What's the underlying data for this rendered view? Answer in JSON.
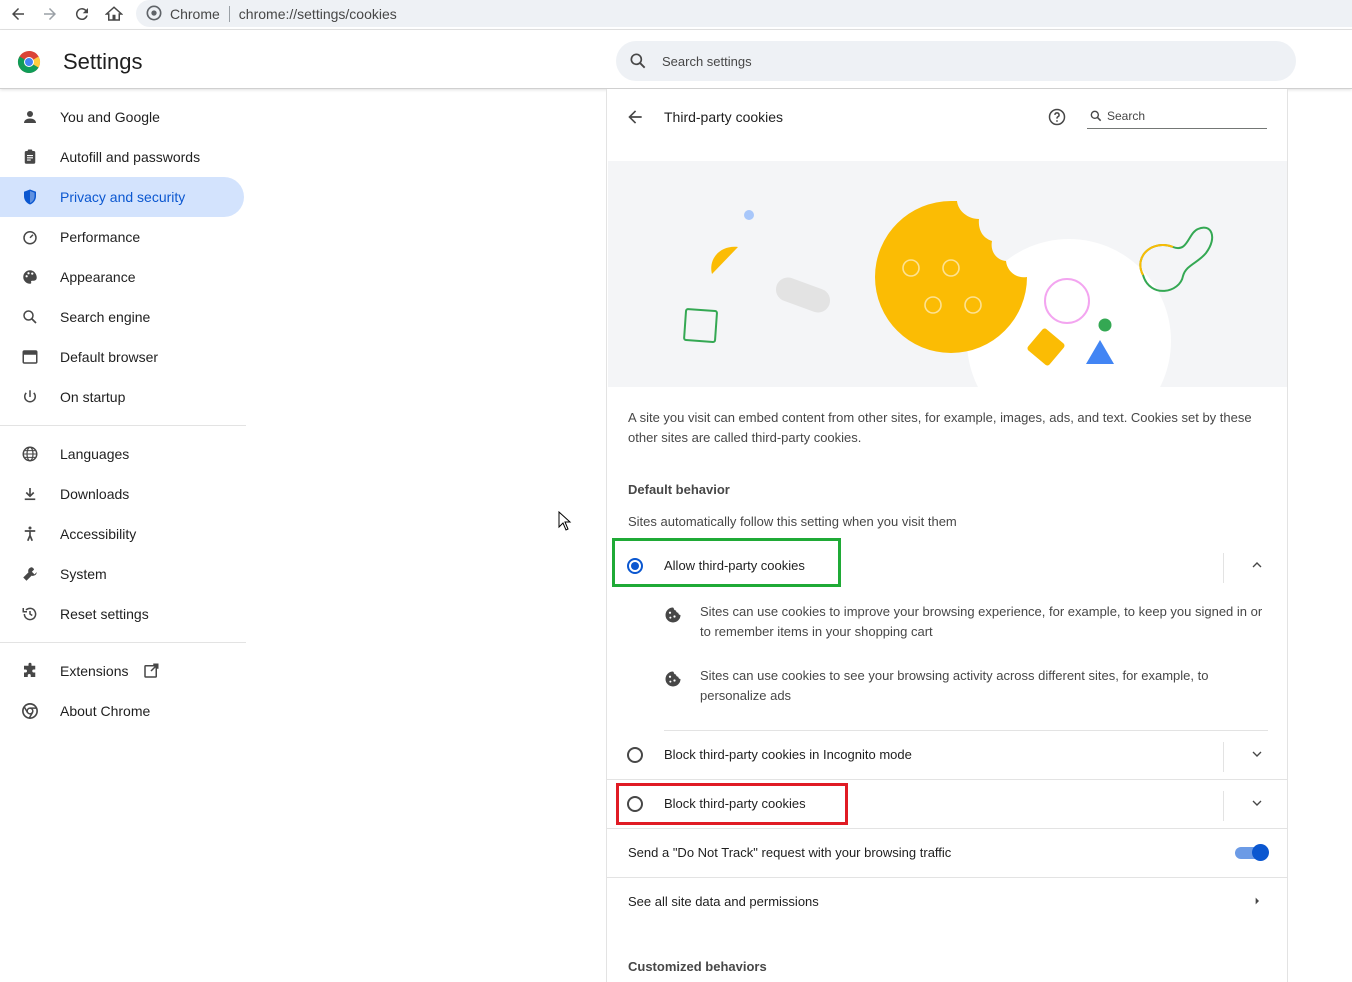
{
  "browser": {
    "site_label": "Chrome",
    "url": "chrome://settings/cookies"
  },
  "header": {
    "title": "Settings",
    "search_placeholder": "Search settings"
  },
  "sidebar": {
    "group1": [
      {
        "label": "You and Google",
        "icon": "person-icon"
      },
      {
        "label": "Autofill and passwords",
        "icon": "clipboard-icon"
      },
      {
        "label": "Privacy and security",
        "icon": "shield-icon",
        "active": true
      },
      {
        "label": "Performance",
        "icon": "speedometer-icon"
      },
      {
        "label": "Appearance",
        "icon": "palette-icon"
      },
      {
        "label": "Search engine",
        "icon": "search-icon"
      },
      {
        "label": "Default browser",
        "icon": "browser-window-icon"
      },
      {
        "label": "On startup",
        "icon": "power-icon"
      }
    ],
    "group2": [
      {
        "label": "Languages",
        "icon": "globe-icon"
      },
      {
        "label": "Downloads",
        "icon": "download-icon"
      },
      {
        "label": "Accessibility",
        "icon": "accessibility-icon"
      },
      {
        "label": "System",
        "icon": "wrench-icon"
      },
      {
        "label": "Reset settings",
        "icon": "history-icon"
      }
    ],
    "group3": [
      {
        "label": "Extensions",
        "icon": "puzzle-icon"
      },
      {
        "label": "About Chrome",
        "icon": "chrome-icon"
      }
    ]
  },
  "page": {
    "title": "Third-party cookies",
    "search_placeholder": "Search",
    "description": "A site you visit can embed content from other sites, for example, images, ads, and text. Cookies set by these other sites are called third-party cookies.",
    "default_behavior_heading": "Default behavior",
    "default_behavior_sub": "Sites automatically follow this setting when you visit them",
    "options": [
      {
        "label": "Allow third-party cookies",
        "checked": true,
        "expanded": true
      },
      {
        "label": "Block third-party cookies in Incognito mode",
        "checked": false,
        "expanded": false
      },
      {
        "label": "Block third-party cookies",
        "checked": false,
        "expanded": false
      }
    ],
    "allow_details": [
      "Sites can use cookies to improve your browsing experience, for example, to keep you signed in or to remember items in your shopping cart",
      "Sites can use cookies to see your browsing activity across different sites, for example, to personalize ads"
    ],
    "do_not_track_label": "Send a \"Do Not Track\" request with your browsing traffic",
    "do_not_track_enabled": true,
    "site_data_link": "See all site data and permissions",
    "customized_heading": "Customized behaviors"
  },
  "colors": {
    "accent": "#0b57d0",
    "active_nav_bg": "#d3e3fd",
    "highlight_green": "#1faa36",
    "highlight_red": "#e01b24"
  }
}
